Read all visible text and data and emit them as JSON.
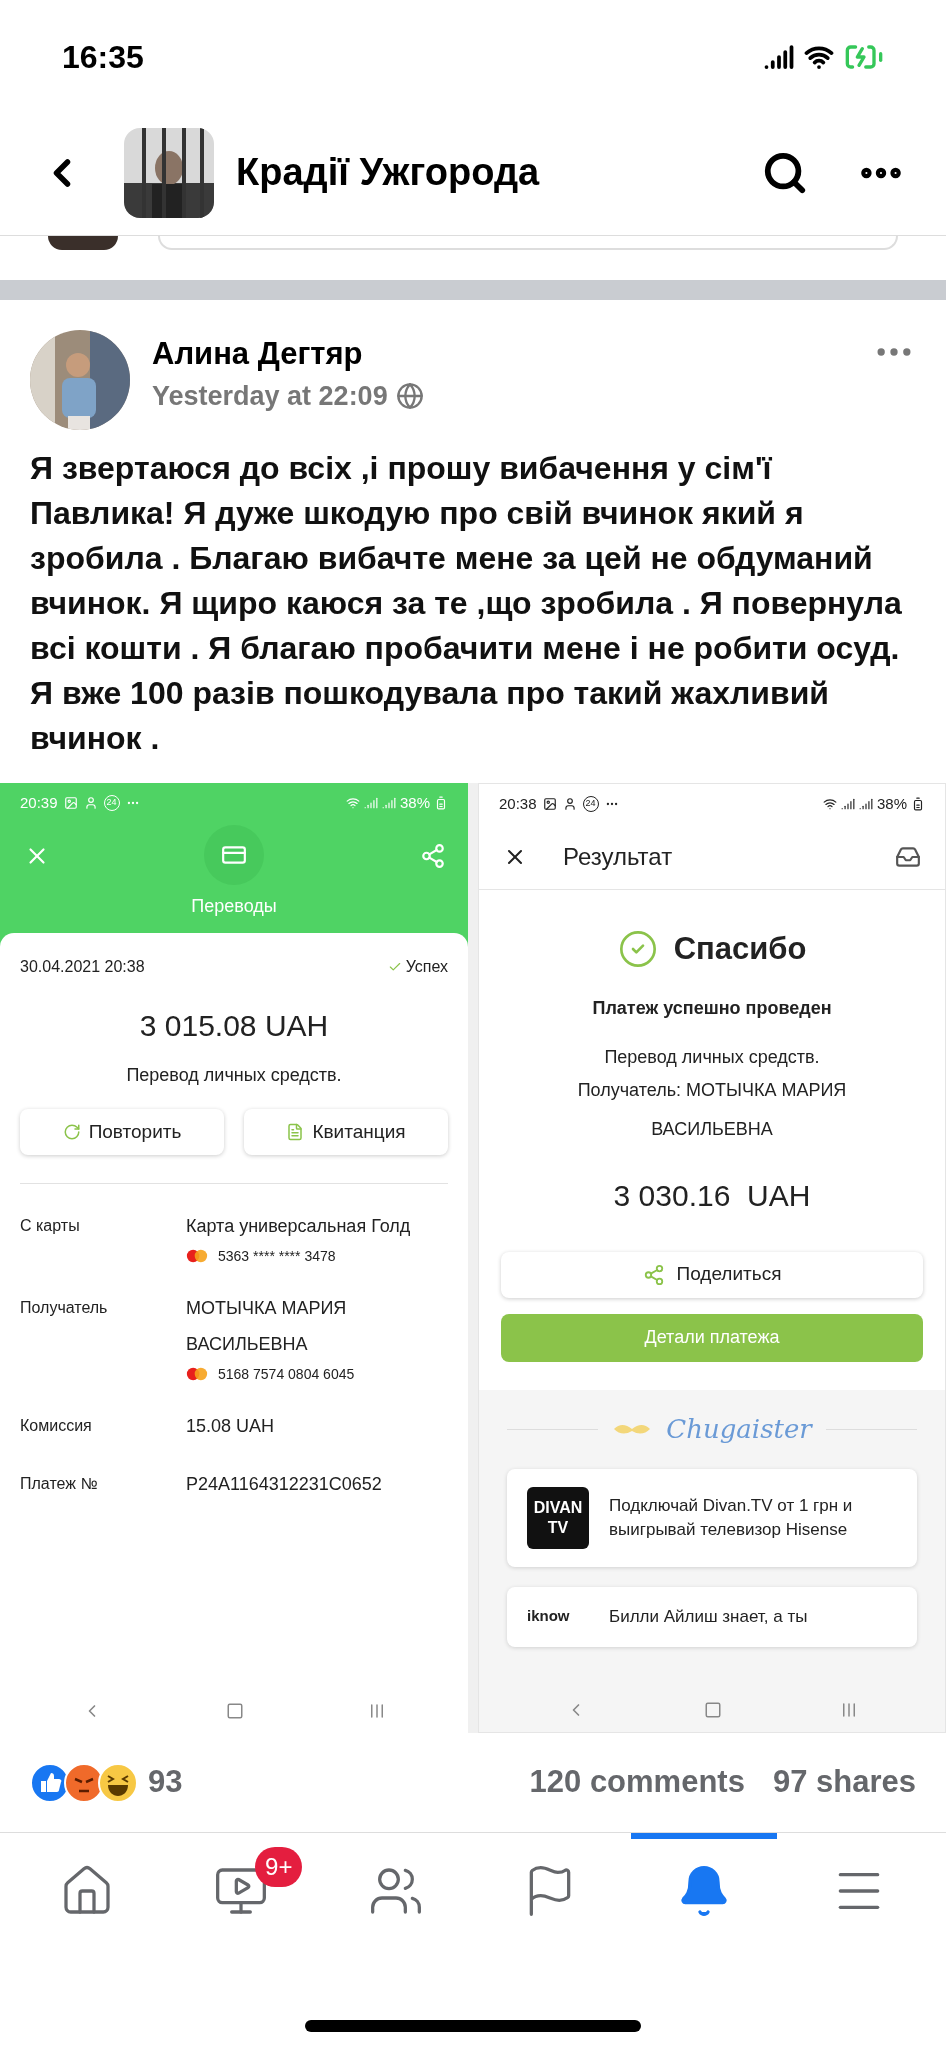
{
  "status_bar": {
    "time": "16:35"
  },
  "header": {
    "title": "Крадії Ужгорода"
  },
  "post": {
    "author": "Алина Дегтяр",
    "time": "Yesterday at 22:09",
    "text": "Я звертаюся до всіх ,і прошу вибачення у сім'ї Павлика! Я дуже шкодую про свій вчинок який я зробила . Благаю вибачте мене за цей не обдуманий вчинок. Я щиро каюся за те ,що зробила . Я повернула всі кошти . Я благаю пробачити мене і не робити осуд. Я вже 100 разів пошкодувала про такий жахливий вчинок ."
  },
  "screenshot_left": {
    "status": {
      "time": "20:39",
      "badge": "24",
      "battery": "38%"
    },
    "title": "Переводы",
    "date": "30.04.2021 20:38",
    "result": "Успех",
    "amount": "3 015.08 UAH",
    "description": "Перевод личных средств.",
    "buttons": [
      {
        "kind": "repeat",
        "label": "Повторить"
      },
      {
        "kind": "receipt",
        "label": "Квитанция"
      }
    ],
    "details": [
      {
        "label": "С карты",
        "value": "Карта универсальная Голд",
        "card": "5363 **** **** 3478"
      },
      {
        "label": "Получатель",
        "value": "МОТЫЧКА МАРИЯ ВАСИЛЬЕВНА",
        "card": "5168 7574 0804 6045"
      },
      {
        "label": "Комиссия",
        "value": "15.08 UAH"
      },
      {
        "label": "Платеж №",
        "value": "P24A1164312231C0652"
      }
    ]
  },
  "screenshot_right": {
    "status": {
      "time": "20:38",
      "badge": "24",
      "battery": "38%"
    },
    "title": "Результат",
    "heading": "Спасибо",
    "subheading": "Платеж успешно проведен",
    "description": "Перевод личных средств.",
    "recipient": "Получатель: МОТЫЧКА МАРИЯ ВАСИЛЬЕВНА",
    "amount": "3 030.16  UAH",
    "share_button": "Поделиться",
    "details_button": "Детали платежа",
    "brand": "Chugaister",
    "ads": [
      {
        "logo": "DIVAN TV",
        "text": "Подключай Divan.TV от 1 грн и выигрывай телевизор Hisense"
      },
      {
        "logo": "iknow",
        "text": "Билли Айлиш знает, а ты"
      }
    ]
  },
  "reactions": {
    "count": "93",
    "comments": "120 comments",
    "shares": "97 shares"
  },
  "tab_bar": {
    "items": [
      {
        "kind": "home",
        "selected": false
      },
      {
        "kind": "video",
        "selected": false,
        "badge": "9+"
      },
      {
        "kind": "groups",
        "selected": false
      },
      {
        "kind": "pages",
        "selected": false
      },
      {
        "kind": "notifications",
        "selected": true
      },
      {
        "kind": "menu",
        "selected": false
      }
    ]
  }
}
